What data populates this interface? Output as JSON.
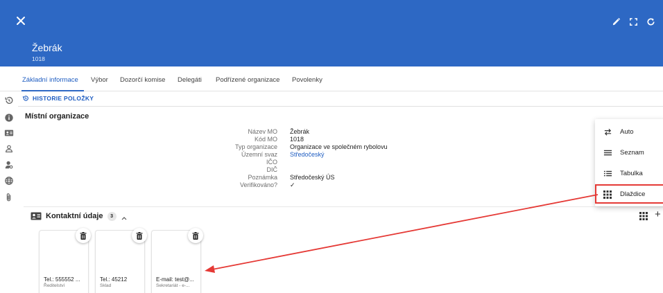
{
  "header": {
    "title": "Žebrák",
    "subtitle": "1018",
    "close_icon": "close-icon",
    "actions": [
      "pencil-icon",
      "fullscreen-icon",
      "refresh-icon"
    ],
    "color": "#2d68c4"
  },
  "tabs": [
    {
      "label": "Základní informace",
      "active": true
    },
    {
      "label": "Výbor"
    },
    {
      "label": "Dozorčí komise"
    },
    {
      "label": "Delegáti"
    },
    {
      "label": "Podřízené organizace"
    },
    {
      "label": "Povolenky"
    }
  ],
  "rail_icons": [
    "history-icon",
    "info-icon",
    "contact-card-icon",
    "members-icon",
    "person-search-icon",
    "globe-icon",
    "attachment-icon"
  ],
  "history": {
    "label": "HISTORIE POLOŽKY"
  },
  "section": {
    "title": "Místní organizace"
  },
  "info": [
    {
      "label": "Název MO",
      "value": "Žebrák"
    },
    {
      "label": "Kód MO",
      "value": "1018"
    },
    {
      "label": "Typ organizace",
      "value": "Organizace ve společném rybolovu"
    },
    {
      "label": "Územní svaz",
      "value": "Středočeský",
      "link": true
    },
    {
      "label": "IČO",
      "value": ""
    },
    {
      "label": "DIČ",
      "value": ""
    },
    {
      "label": "Poznámka",
      "value": "Středočeský ÚS"
    },
    {
      "label": "Verifikováno?",
      "value": "✓"
    }
  ],
  "contacts": {
    "label": "Kontaktní údaje",
    "count": "3",
    "tiles": [
      {
        "main": "Tel.: 555552 ...",
        "sub": "Ředitelství"
      },
      {
        "main": "Tel.: 45212",
        "sub": "Sklad"
      },
      {
        "main": "E-mail: test@...",
        "sub": "Sekretariát - e-..."
      }
    ]
  },
  "view_menu": {
    "items": [
      {
        "label": "Auto",
        "icon": "swap-icon"
      },
      {
        "label": "Seznam",
        "icon": "list-icon"
      },
      {
        "label": "Tabulka",
        "icon": "table-list-icon"
      },
      {
        "label": "Dlaždice",
        "icon": "tiles-grid-icon",
        "highlighted": true
      }
    ]
  },
  "colors": {
    "accent": "#2d68c4",
    "link": "#1d5cc1",
    "annotation": "#e53935"
  }
}
